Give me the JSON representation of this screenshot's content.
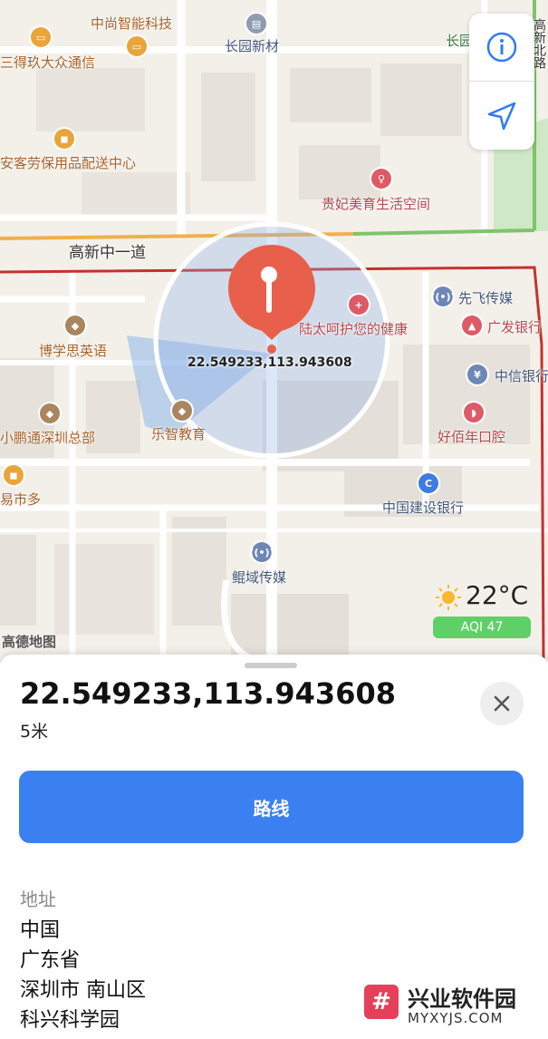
{
  "map": {
    "pois": [
      {
        "label": "中尚智能科技",
        "icon": "tv-icon"
      },
      {
        "label": "长园新材",
        "icon": "building-icon"
      },
      {
        "label": "长园",
        "icon": ""
      },
      {
        "label": "三得玖大众通信",
        "icon": "tv-icon"
      },
      {
        "label": "安客劳保用品配送中心",
        "icon": "bag-icon"
      },
      {
        "label": "贵妃美育生活空间",
        "icon": "beauty-icon"
      },
      {
        "label": "先飞传媒",
        "icon": "radio-tower-icon"
      },
      {
        "label": "陆太呵护您的健康",
        "icon": "medical-icon"
      },
      {
        "label": "广发银行",
        "icon": "bank-icon"
      },
      {
        "label": "博学思英语",
        "icon": "graduation-cap-icon"
      },
      {
        "label": "中信银行",
        "icon": "bank-icon"
      },
      {
        "label": "乐智教育",
        "icon": "graduation-cap-icon"
      },
      {
        "label": "好佰年口腔",
        "icon": "tooth-icon"
      },
      {
        "label": "小鹏通深圳总部",
        "icon": "graduation-cap-icon"
      },
      {
        "label": "中国建设银行",
        "icon": "bank-icon"
      },
      {
        "label": "易市多",
        "icon": "shop-icon"
      },
      {
        "label": "鲲域传媒",
        "icon": "radio-tower-icon"
      }
    ],
    "road_label": "高新中一道",
    "street_label_edge": "高新北路",
    "pin_coordinates": "22.549233,113.943608",
    "provider_logo": "高德地图",
    "weather": {
      "temperature": "22°C",
      "aqi": "AQI 47",
      "icon": "sun-icon"
    },
    "controls": {
      "info_icon": "info-icon",
      "locate_icon": "location-arrow-icon"
    },
    "colors": {
      "accuracy_circle": "#5b8fe0",
      "pin": "#e8604c",
      "route_button": "#3b80f0",
      "aqi_badge": "#5fd068"
    }
  },
  "sheet": {
    "title": "22.549233,113.943608",
    "accuracy": "5米",
    "route_button": "路线",
    "address_label": "地址",
    "address_lines": [
      "中国",
      "广东省",
      "深圳市 南山区",
      "科兴科学园"
    ]
  },
  "watermark": {
    "name": "兴业软件园",
    "url": "MYXYJS.COM",
    "logo_glyph": "#"
  }
}
